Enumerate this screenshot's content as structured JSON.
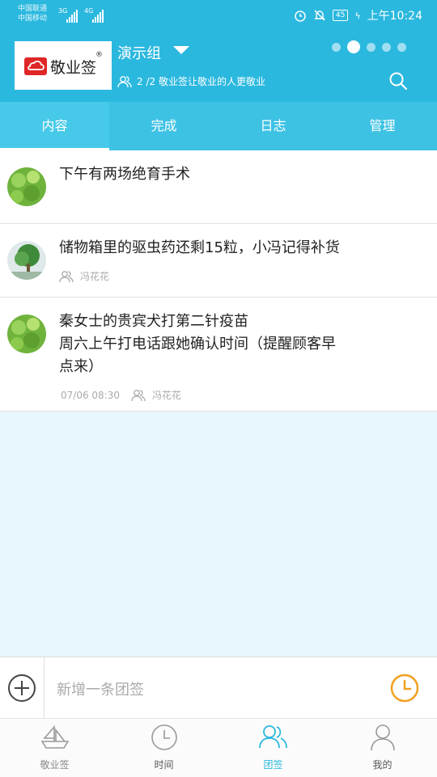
{
  "status_bar": {
    "carrier1": "中国联通",
    "carrier2": "中国移动",
    "net1": "3G",
    "net2": "4G",
    "battery": "45",
    "time": "上午10:24"
  },
  "header": {
    "logo_text": "敬业签",
    "logo_reg": "®",
    "group_name": "演示组",
    "group_subtitle": "2 /2 敬业签让敬业的人更敬业"
  },
  "tabs": [
    {
      "label": "内容"
    },
    {
      "label": "完成"
    },
    {
      "label": "日志"
    },
    {
      "label": "管理"
    }
  ],
  "items": [
    {
      "title_lines": [
        "下午有两场绝育手术"
      ],
      "meta_date": "",
      "meta_user": ""
    },
    {
      "title_lines": [
        "储物箱里的驱虫药还剩15粒，小冯记得补货"
      ],
      "meta_date": "",
      "meta_user": "冯花花"
    },
    {
      "title_lines": [
        "秦女士的贵宾犬打第二针疫苗",
        "周六上午打电话跟她确认时间（提醒顾客早",
        "点来）"
      ],
      "meta_date": "07/06  08:30",
      "meta_user": "冯花花"
    }
  ],
  "input_bar": {
    "placeholder": "新增一条团签"
  },
  "bottom_nav": [
    {
      "label": "敬业签",
      "icon": "boat-icon"
    },
    {
      "label": "时间",
      "icon": "clock-icon"
    },
    {
      "label": "团签",
      "icon": "group-icon"
    },
    {
      "label": "我的",
      "icon": "person-icon"
    }
  ],
  "colors": {
    "accent": "#2bb8df",
    "clock": "#f0a020",
    "brand_red": "#e02727"
  }
}
